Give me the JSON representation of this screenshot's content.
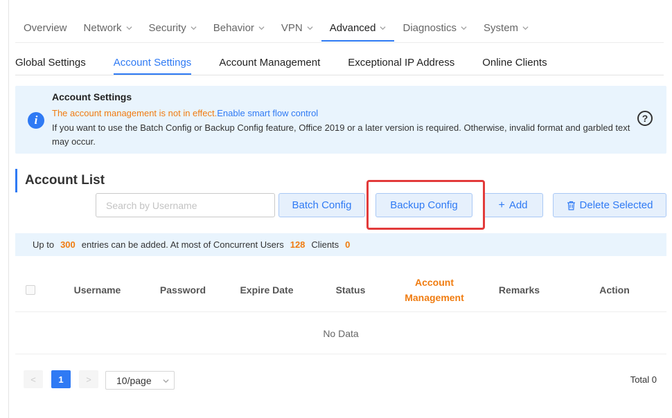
{
  "topnav": {
    "items": [
      {
        "label": "Overview",
        "dropdown": false
      },
      {
        "label": "Network",
        "dropdown": true
      },
      {
        "label": "Security",
        "dropdown": true
      },
      {
        "label": "Behavior",
        "dropdown": true
      },
      {
        "label": "VPN",
        "dropdown": true
      },
      {
        "label": "Advanced",
        "dropdown": true,
        "active": true
      },
      {
        "label": "Diagnostics",
        "dropdown": true
      },
      {
        "label": "System",
        "dropdown": true
      }
    ]
  },
  "subtabs": [
    {
      "label": "Global Settings"
    },
    {
      "label": "Account Settings",
      "active": true
    },
    {
      "label": "Account Management"
    },
    {
      "label": "Exceptional IP Address"
    },
    {
      "label": "Online Clients"
    }
  ],
  "info": {
    "title": "Account Settings",
    "warning": "The account management is not in effect.",
    "link": "Enable smart flow control",
    "note": "If you want to use the Batch Config or Backup Config feature, Office 2019 or a later version is required. Otherwise, invalid format and garbled text may occur.",
    "icon": "info-icon",
    "help_icon": "question-circle-icon"
  },
  "account_list": {
    "title": "Account List",
    "search_placeholder": "Search by Username",
    "buttons": {
      "batch": "Batch Config",
      "backup": "Backup Config",
      "add": "Add",
      "add_glyph": "+",
      "delete": "Delete Selected"
    }
  },
  "limits": {
    "prefix": "Up to",
    "max_entries": "300",
    "middle": "entries can be added. At most of Concurrent Users",
    "concurrent": "128",
    "clients_label": "Clients",
    "clients": "0"
  },
  "table": {
    "columns": [
      "Username",
      "Password",
      "Expire Date",
      "Status",
      "Account Management",
      "Remarks",
      "Action"
    ],
    "empty": "No Data"
  },
  "pagination": {
    "prev": "<",
    "current_page": "1",
    "next": ">",
    "page_size": "10/page",
    "total": "Total 0"
  },
  "colors": {
    "accent": "#2f7af4",
    "warning": "#f07c10",
    "highlight": "#e23b3b",
    "info_bg": "#e9f4fd"
  }
}
